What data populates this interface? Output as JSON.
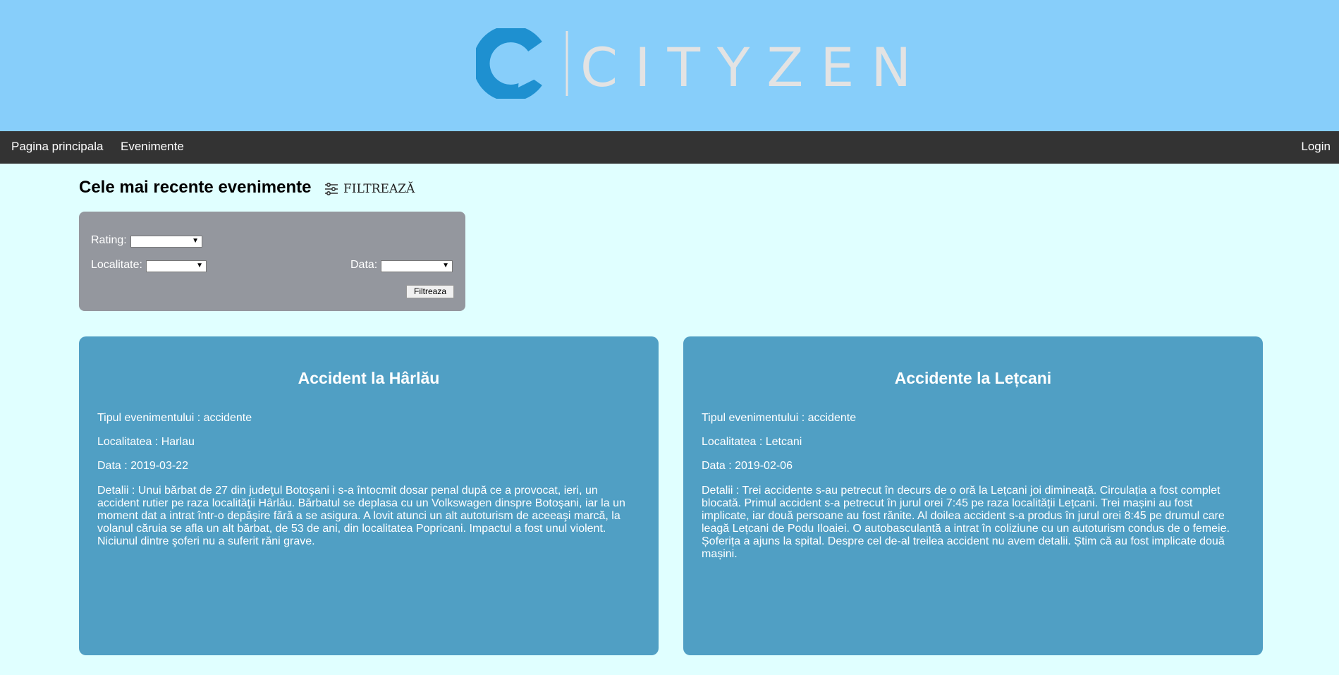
{
  "brand": {
    "name": "CITYZEN",
    "colors": {
      "logo_c": "#1e90d0",
      "header_bg": "#87cefa",
      "nav_bg": "#333333",
      "card_bg": "#509fc4"
    }
  },
  "nav": {
    "items": [
      "Pagina principala",
      "Evenimente"
    ],
    "login": "Login"
  },
  "page": {
    "title": "Cele mai recente evenimente",
    "filter_toggle": "FILTREAZĂ",
    "filter_icon": "sliders-icon"
  },
  "filter": {
    "rating_label": "Rating:",
    "localitate_label": "Localitate:",
    "data_label": "Data:",
    "rating_value": "",
    "localitate_value": "",
    "data_value": "",
    "button": "Filtreaza"
  },
  "events": [
    {
      "title": "Accident la Hârlău",
      "tip": "Tipul evenimentului : accidente",
      "localitate": "Localitatea : Harlau",
      "data": "Data : 2019-03-22",
      "detalii": "Detalii : Unui bărbat de 27 din judeţul Botoşani i s-a întocmit dosar penal după ce a provocat, ieri, un accident rutier pe raza localităţii Hârlău. Bărbatul se deplasa cu un Volkswagen dinspre Botoşani, iar la un moment dat a intrat într-o depăşire fără a se asigura. A lovit atunci un alt autoturism de aceeaşi marcă, la volanul căruia se afla un alt bărbat, de 53 de ani, din localitatea Popricani. Impactul a fost unul violent. Niciunul dintre şoferi nu a suferit răni grave."
    },
    {
      "title": "Accidente la Lețcani",
      "tip": "Tipul evenimentului : accidente",
      "localitate": "Localitatea : Letcani",
      "data": "Data : 2019-02-06",
      "detalii": "Detalii : Trei accidente s-au petrecut în decurs de o oră la Lețcani joi dimineață. Circulația a fost complet blocată. Primul accident s-a petrecut în jurul orei 7:45 pe raza localității Lețcani. Trei mașini au fost implicate, iar două persoane au fost rănite. Al doilea accident s-a produs în jurul orei 8:45 pe drumul care leagă Lețcani de Podu Iloaiei. O autobasculantă a intrat în coliziune cu un autoturism condus de o femeie. Șoferița a ajuns la spital. Despre cel de-al treilea accident nu avem detalii. Știm că au fost implicate două mașini."
    }
  ]
}
